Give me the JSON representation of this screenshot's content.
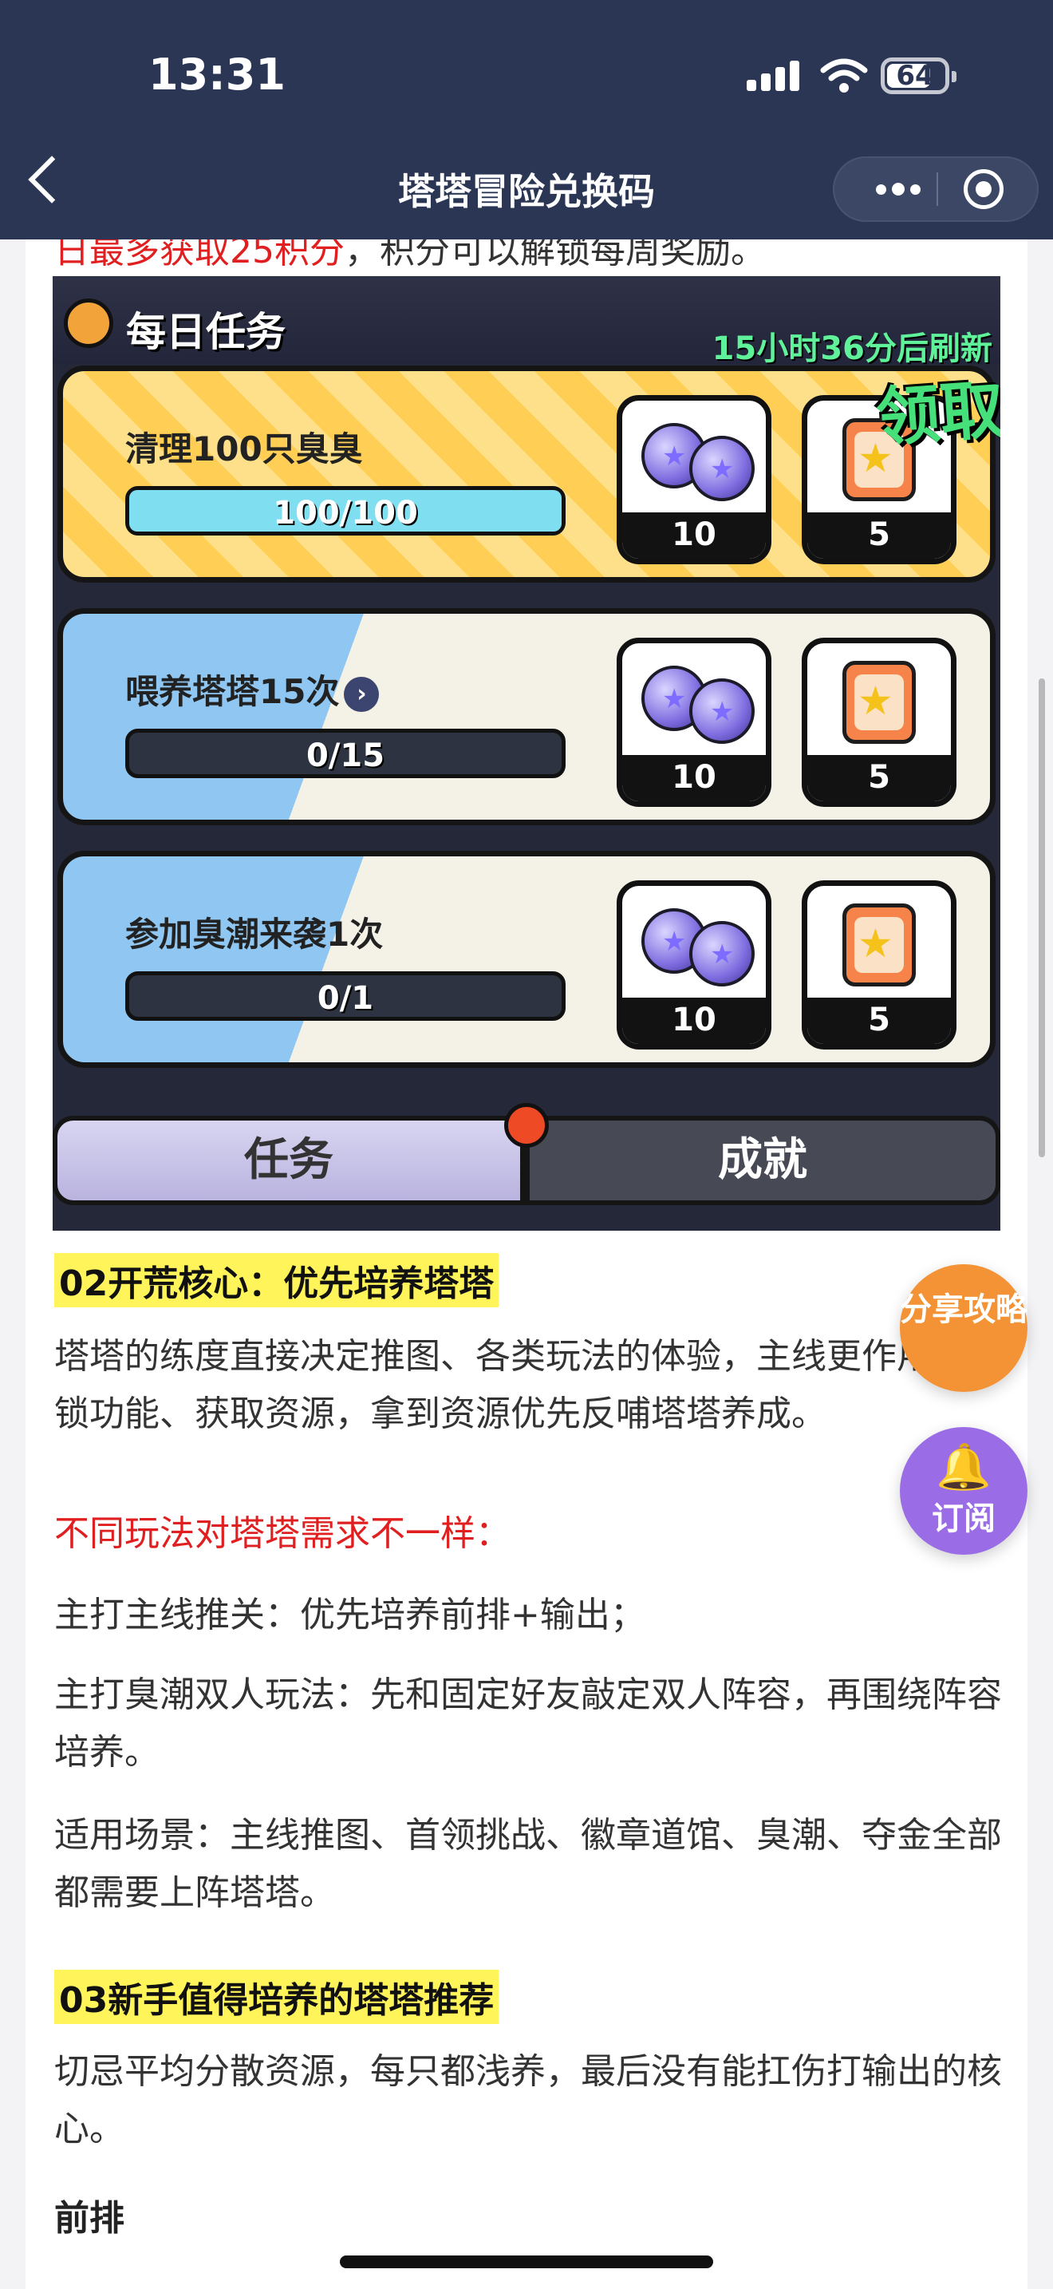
{
  "status_bar": {
    "time": "13:31",
    "battery": "64"
  },
  "nav": {
    "title": "塔塔冒险兑换码"
  },
  "article": {
    "cut_off_line_red": "日最多获取25积分",
    "cut_off_line_rest": "，积分可以解锁每周奖励。",
    "game_screenshot": {
      "title": "每日任务",
      "refresh": "15小时36分后刷新",
      "claim": "领取",
      "tasks": [
        {
          "name": "清理100只臭臭",
          "progress": "100/100",
          "progress_fraction": 1.0,
          "reward1": "10",
          "reward2": "5"
        },
        {
          "name": "喂养塔塔15次",
          "progress": "0/15",
          "progress_fraction": 0.0,
          "reward1": "10",
          "reward2": "5"
        },
        {
          "name": "参加臭潮来袭1次",
          "progress": "0/1",
          "progress_fraction": 0.0,
          "reward1": "10",
          "reward2": "5"
        }
      ],
      "tab_tasks": "任务",
      "tab_achievements": "成就"
    },
    "heading2": "02开荒核心：优先培养塔塔",
    "para1": "塔塔的练度直接决定推图、各类玩法的体验，主线更作用是解锁功能、获取资源，拿到资源优先反哺塔塔养成。",
    "para_red": "不同玩法对塔塔需求不一样：",
    "para2": "主打主线推关：优先培养前排+输出；",
    "para3": "主打臭潮双人玩法：先和固定好友敲定双人阵容，再围绕阵容培养。",
    "para4": "适用场景：主线推图、首领挑战、徽章道馆、臭潮、夺金全部都需要上阵塔塔。",
    "heading3": "03新手值得培养的塔塔推荐",
    "para5": "切忌平均分散资源，每只都浅养，最后没有能扛伤打输出的核心。",
    "subheading": "前排"
  },
  "floating": {
    "share": "分享攻略",
    "subscribe": "订阅"
  },
  "colors": {
    "nav_bg": "#2b3655",
    "highlight": "#fff55a",
    "red_text": "#e02020",
    "share_fab": "#f49336",
    "subscribe_fab": "#9a6de6"
  }
}
